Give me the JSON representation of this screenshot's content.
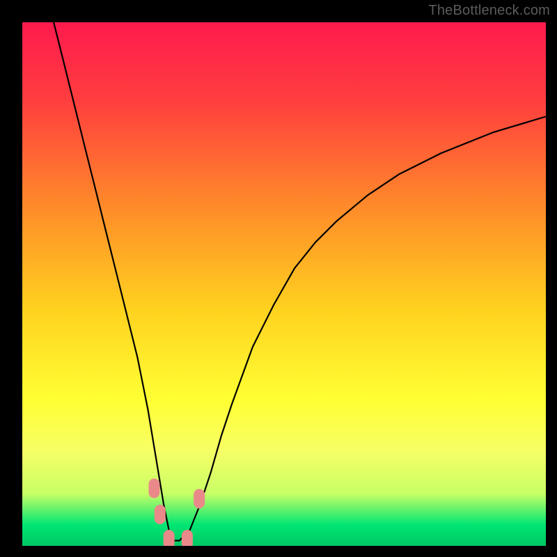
{
  "watermark": "TheBottleneck.com",
  "chart_data": {
    "type": "line",
    "title": "",
    "xlabel": "",
    "ylabel": "",
    "xlim": [
      0,
      100
    ],
    "ylim": [
      0,
      100
    ],
    "background_gradient": {
      "stops": [
        {
          "pos": 0.0,
          "color": "#ff1a4d"
        },
        {
          "pos": 0.15,
          "color": "#ff3e3e"
        },
        {
          "pos": 0.35,
          "color": "#ff8a2a"
        },
        {
          "pos": 0.55,
          "color": "#ffd21f"
        },
        {
          "pos": 0.72,
          "color": "#ffff33"
        },
        {
          "pos": 0.82,
          "color": "#f6ff66"
        },
        {
          "pos": 0.9,
          "color": "#c8ff66"
        },
        {
          "pos": 0.96,
          "color": "#00e673"
        },
        {
          "pos": 1.0,
          "color": "#00c864"
        }
      ]
    },
    "series": [
      {
        "name": "bottleneck-curve",
        "color": "#000000",
        "x": [
          6,
          8,
          10,
          12,
          14,
          16,
          18,
          20,
          22,
          24,
          26,
          27,
          28,
          29,
          30,
          32,
          34,
          36,
          38,
          40,
          44,
          48,
          52,
          56,
          60,
          66,
          72,
          80,
          90,
          100
        ],
        "y": [
          100,
          92,
          84,
          76,
          68,
          60,
          52,
          44,
          36,
          26,
          14,
          8,
          3,
          1,
          1,
          3,
          8,
          14,
          21,
          27,
          38,
          46,
          53,
          58,
          62,
          67,
          71,
          75,
          79,
          82
        ]
      }
    ],
    "markers": [
      {
        "name": "left-marker-1",
        "x": 25.2,
        "y": 11.0,
        "color": "#e98989"
      },
      {
        "name": "left-marker-2",
        "x": 26.3,
        "y": 6.0,
        "color": "#e98989"
      },
      {
        "name": "bottom-marker-1",
        "x": 28.0,
        "y": 1.2,
        "color": "#e98989"
      },
      {
        "name": "bottom-marker-2",
        "x": 31.5,
        "y": 1.2,
        "color": "#e98989"
      },
      {
        "name": "right-marker-1",
        "x": 33.8,
        "y": 9.0,
        "color": "#e98989"
      }
    ]
  }
}
